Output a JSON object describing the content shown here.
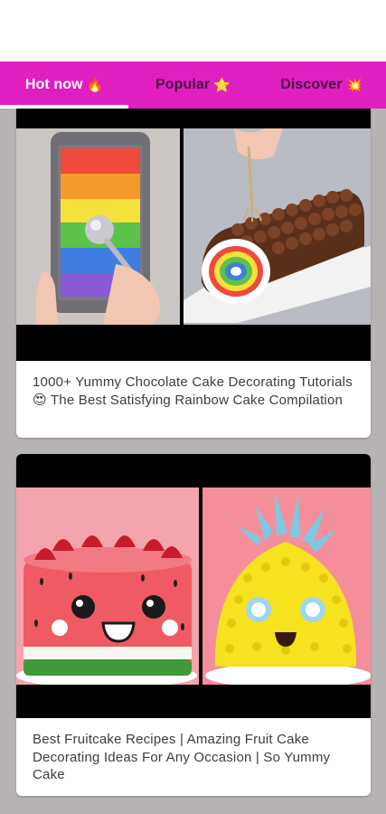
{
  "tabs": [
    {
      "label": "Hot now",
      "emoji": "🔥",
      "active": true
    },
    {
      "label": "Popular",
      "emoji": "⭐",
      "active": false
    },
    {
      "label": "Discover",
      "emoji": "💥",
      "active": false
    }
  ],
  "videos": [
    {
      "title": "1000+ Yummy Chocolate Cake Decorating Tutorials 😍 The Best Satisfying Rainbow Cake Compilation"
    },
    {
      "title": "Best Fruitcake Recipes | Amazing Fruit Cake Decorating Ideas For Any Occasion | So Yummy Cake"
    }
  ],
  "colors": {
    "accent": "#e01fc1",
    "feed_background": "#b7b3b2"
  }
}
